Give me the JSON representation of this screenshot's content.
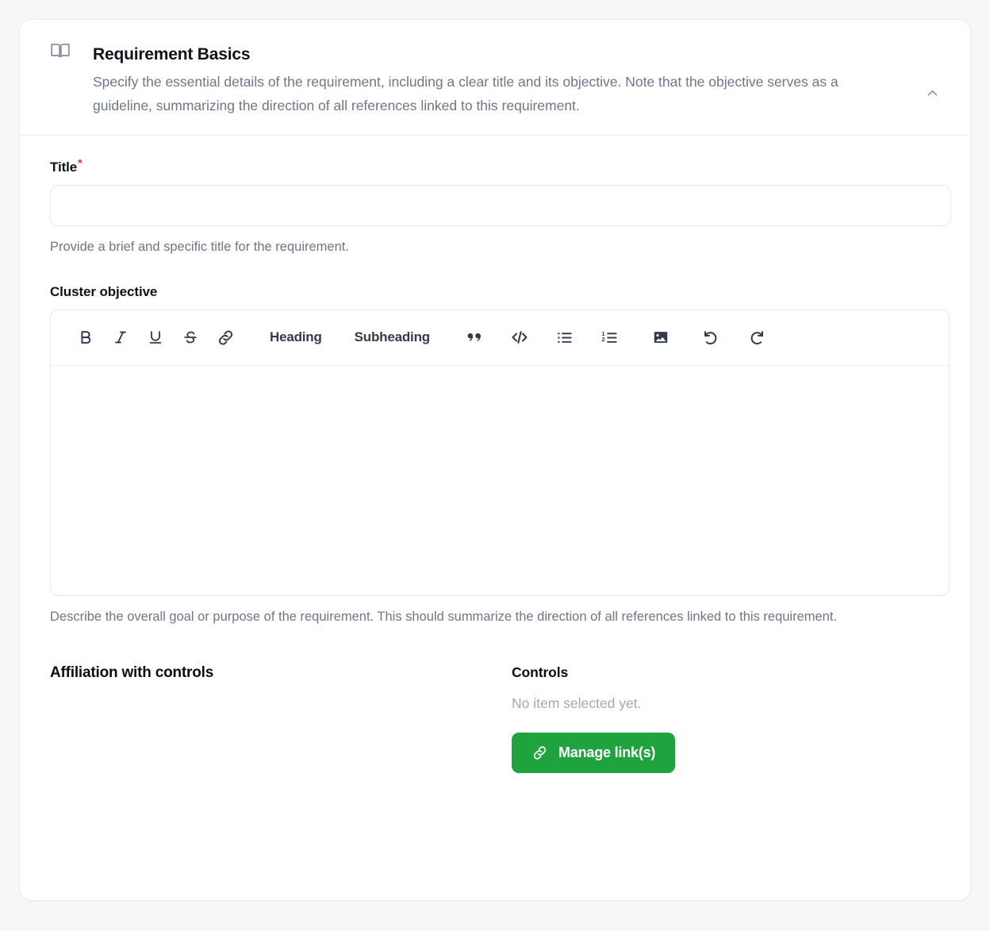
{
  "theme": {
    "page_background": "#f6f7f9",
    "card_background": "#ffffff",
    "accent_green": "#1fa33f",
    "required_red": "#e8285c",
    "muted_text": "#6e7689",
    "placeholder_text": "#a2a9b8"
  },
  "section": {
    "icon": "open-book-icon",
    "title": "Requirement Basics",
    "description": "Specify the essential details of the requirement, including a clear title and its objective. Note that the objective serves as a guideline, summarizing the direction of all references linked to this requirement.",
    "collapse_icon": "chevron-up-icon"
  },
  "fields": {
    "title": {
      "label": "Title",
      "required_marker": "*",
      "value": "",
      "placeholder": "",
      "help": "Provide a brief and specific title for the requirement."
    },
    "cluster_objective": {
      "label": "Cluster objective",
      "value": "",
      "placeholder": "",
      "help": "Describe the overall goal or purpose of the requirement. This should summarize the direction of all references linked to this requirement."
    }
  },
  "editor_toolbar": [
    {
      "name": "bold-button",
      "icon": "bold-icon",
      "label": "B",
      "type": "glyph"
    },
    {
      "name": "italic-button",
      "icon": "italic-icon",
      "label": "I",
      "type": "glyph"
    },
    {
      "name": "underline-button",
      "icon": "underline-icon",
      "label": "U",
      "type": "glyph"
    },
    {
      "name": "strikethrough-button",
      "icon": "strikethrough-icon",
      "label": "S",
      "type": "glyph"
    },
    {
      "name": "link-button",
      "icon": "link-icon",
      "label": "",
      "type": "icon"
    },
    {
      "name": "heading-button",
      "icon": "heading-icon",
      "label": "Heading",
      "type": "text"
    },
    {
      "name": "subheading-button",
      "icon": "subheading-icon",
      "label": "Subheading",
      "type": "text"
    },
    {
      "name": "blockquote-button",
      "icon": "quote-icon",
      "label": "",
      "type": "icon"
    },
    {
      "name": "code-block-button",
      "icon": "code-icon",
      "label": "",
      "type": "icon"
    },
    {
      "name": "bullet-list-button",
      "icon": "bullet-list-icon",
      "label": "",
      "type": "icon"
    },
    {
      "name": "numbered-list-button",
      "icon": "numbered-list-icon",
      "label": "",
      "type": "icon"
    },
    {
      "name": "image-button",
      "icon": "image-icon",
      "label": "",
      "type": "icon"
    },
    {
      "name": "undo-button",
      "icon": "undo-icon",
      "label": "",
      "type": "icon"
    },
    {
      "name": "redo-button",
      "icon": "redo-icon",
      "label": "",
      "type": "icon"
    }
  ],
  "affiliation": {
    "heading": "Affiliation with controls",
    "controls": {
      "title": "Controls",
      "empty_text": "No item selected yet.",
      "button_label": "Manage link(s)",
      "button_icon": "link-icon"
    }
  }
}
